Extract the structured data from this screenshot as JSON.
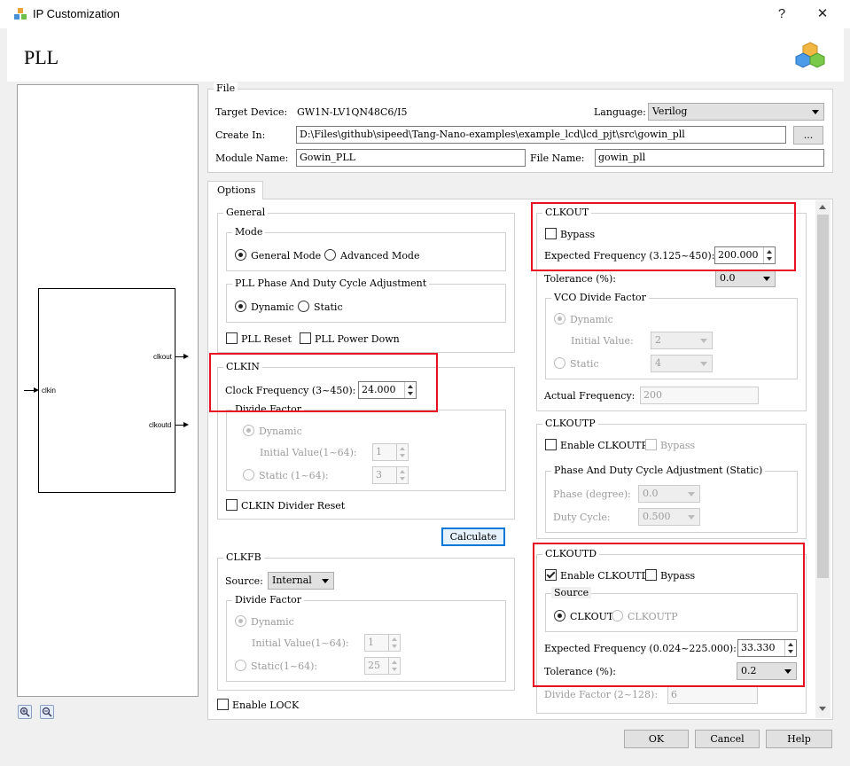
{
  "window": {
    "title": "IP Customization",
    "help_label": "?",
    "close_label": "✕",
    "heading": "PLL",
    "icon": "cubes-icon"
  },
  "diagram": {
    "input_port": "clkin",
    "output_ports": [
      "clkout",
      "clkoutd"
    ],
    "zoom_in_icon": "zoom-in-icon",
    "zoom_out_icon": "zoom-out-icon"
  },
  "file": {
    "group_title": "File",
    "target_device_label": "Target Device:",
    "target_device_value": "GW1N-LV1QN48C6/I5",
    "language_label": "Language:",
    "language_value": "Verilog",
    "create_in_label": "Create In:",
    "create_in_value": "D:\\Files\\github\\sipeed\\Tang-Nano-examples\\example_lcd\\lcd_pjt\\src\\gowin_pll",
    "browse_label": "...",
    "module_name_label": "Module Name:",
    "module_name_value": "Gowin_PLL",
    "file_name_label": "File Name:",
    "file_name_value": "gowin_pll"
  },
  "options": {
    "tab_label": "Options",
    "general": {
      "title": "General",
      "mode_title": "Mode",
      "general_mode": "General Mode",
      "advanced_mode": "Advanced Mode",
      "phase_title": "PLL Phase And Duty Cycle Adjustment",
      "dynamic": "Dynamic",
      "static": "Static",
      "pll_reset": "PLL Reset",
      "pll_power_down": "PLL Power Down"
    },
    "clkin": {
      "title": "CLKIN",
      "clock_freq_label": "Clock Frequency (3~450):",
      "clock_freq_value": "24.000",
      "divide_title": "Divide Factor",
      "dynamic": "Dynamic",
      "initial_label": "Initial Value(1~64):",
      "initial_value": "1",
      "static_label": "Static (1~64):",
      "static_value": "3",
      "divider_reset": "CLKIN Divider Reset"
    },
    "calculate_label": "Calculate",
    "clkfb": {
      "title": "CLKFB",
      "source_label": "Source:",
      "source_value": "Internal",
      "divide_title": "Divide Factor",
      "dynamic": "Dynamic",
      "initial_label": "Initial Value(1~64):",
      "initial_value": "1",
      "static_label": "Static(1~64):",
      "static_value": "25"
    },
    "enable_lock": "Enable LOCK",
    "clkout": {
      "title": "CLKOUT",
      "bypass": "Bypass",
      "expected_label": "Expected Frequency (3.125~450):",
      "expected_value": "200.000",
      "tolerance_label": "Tolerance (%):",
      "tolerance_value": "0.0",
      "vco_title": "VCO Divide Factor",
      "dynamic": "Dynamic",
      "initial_label": "Initial Value:",
      "initial_value": "2",
      "static_label": "Static",
      "static_value": "4",
      "actual_label": "Actual Frequency:",
      "actual_value": "200"
    },
    "clkoutp": {
      "title": "CLKOUTP",
      "enable": "Enable CLKOUTP",
      "bypass": "Bypass",
      "phase_title": "Phase And Duty Cycle Adjustment (Static)",
      "phase_label": "Phase (degree):",
      "phase_value": "0.0",
      "duty_label": "Duty Cycle:",
      "duty_value": "0.500"
    },
    "clkoutd": {
      "title": "CLKOUTD",
      "enable": "Enable CLKOUTD",
      "bypass": "Bypass",
      "source_title": "Source",
      "source_clkout": "CLKOUT",
      "source_clkoutp": "CLKOUTP",
      "expected_label": "Expected Frequency (0.024~225.000):",
      "expected_value": "33.330",
      "tolerance_label": "Tolerance (%):",
      "tolerance_value": "0.2",
      "divide_label": "Divide Factor (2~128):",
      "divide_value": "6"
    }
  },
  "buttons": {
    "ok": "OK",
    "cancel": "Cancel",
    "help": "Help"
  },
  "colors": {
    "highlight": "#e81123",
    "focus": "#0078d7"
  }
}
